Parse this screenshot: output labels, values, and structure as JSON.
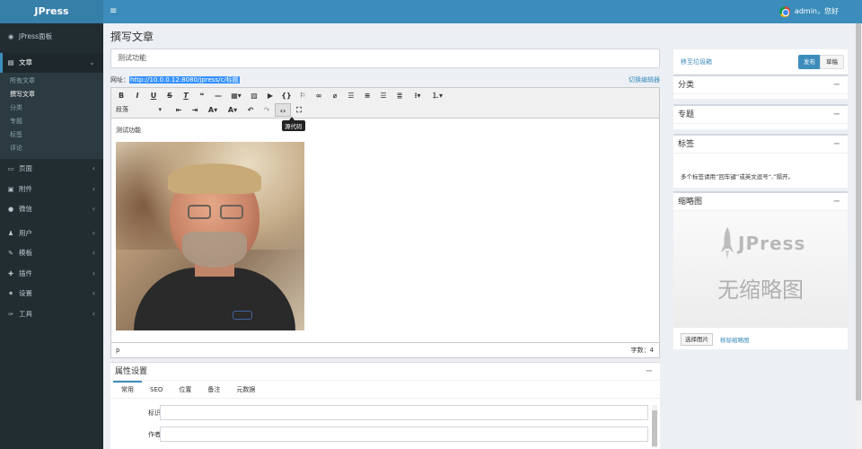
{
  "app": {
    "logo": "JPress",
    "menu_toggle": "≡"
  },
  "header": {
    "user_text": "admin，您好"
  },
  "sidebar": {
    "dashboard": {
      "icon": "dashboard-icon",
      "label": "JPress面板"
    },
    "article": {
      "icon": "article-icon",
      "label": "文章",
      "sub": [
        "所有文章",
        "撰写文章",
        "分类",
        "专题",
        "标签",
        "评论"
      ]
    },
    "items": [
      {
        "icon": "page-icon",
        "label": "页面"
      },
      {
        "icon": "attachment-icon",
        "label": "附件"
      },
      {
        "icon": "wechat-icon",
        "label": "微信"
      },
      {
        "icon": "user-icon",
        "label": "用户"
      },
      {
        "icon": "template-icon",
        "label": "模板"
      },
      {
        "icon": "plugin-icon",
        "label": "插件"
      },
      {
        "icon": "settings-icon",
        "label": "设置"
      },
      {
        "icon": "tools-icon",
        "label": "工具"
      }
    ]
  },
  "page": {
    "title": "撰写文章",
    "article_title": "测试功能",
    "url_label": "网址：",
    "url": "http://10.0.0.12:8080/jpress/c/标题",
    "switch_editor": "切换编辑器"
  },
  "editor": {
    "format_select": "段落",
    "tooltip": "源代码",
    "content_text": "测试功能",
    "status_path": "p",
    "word_count": "字数：4"
  },
  "attributes": {
    "title": "属性设置",
    "tabs": [
      "常用",
      "SEO",
      "位置",
      "备注",
      "元数据"
    ],
    "fields": [
      "标识",
      "作者"
    ]
  },
  "right": {
    "publish": {
      "trash_link": "移至垃圾箱",
      "publish_btn": "发布",
      "draft_btn": "草稿"
    },
    "category": {
      "title": "分类"
    },
    "topic": {
      "title": "专题"
    },
    "tags": {
      "title": "标签",
      "tip": "多个标签请用“回车键”或英文逗号“,”隔开。"
    },
    "thumbnail": {
      "title": "缩略图",
      "brand": "JPress",
      "placeholder": "无缩略图",
      "pick_btn": "选择图片",
      "remove_link": "移除缩略图"
    },
    "collapse_symbol": "−"
  },
  "colors": {
    "header_blue": "#3c8dbc",
    "sidebar_dark": "#222d32",
    "accent": "#3c8dbc"
  }
}
